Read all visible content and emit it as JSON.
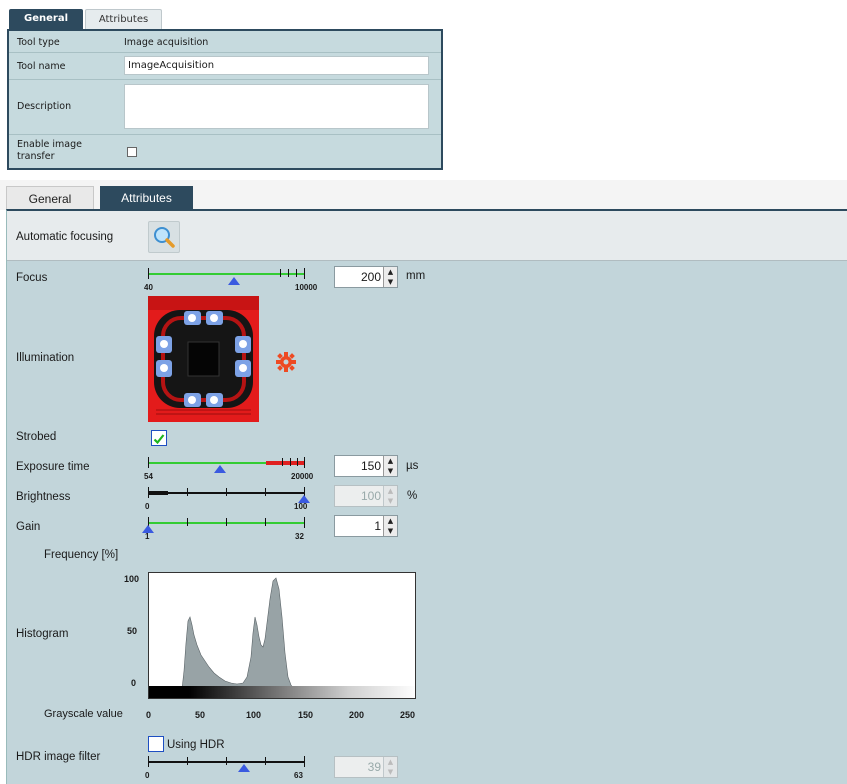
{
  "general_panel": {
    "tabs": {
      "general": "General",
      "attributes": "Attributes"
    },
    "tool_type_label": "Tool type",
    "tool_type_value": "Image acquisition",
    "tool_name_label": "Tool name",
    "tool_name_value": "ImageAcquisition",
    "description_label": "Description",
    "description_value": "",
    "enable_label_1": "Enable image",
    "enable_label_2": "transfer",
    "enable_checked": false
  },
  "attributes_panel": {
    "tabs": {
      "general": "General",
      "attributes": "Attributes"
    },
    "automatic_focusing_label": "Automatic focusing",
    "focus": {
      "label": "Focus",
      "min": "40",
      "max": "10000",
      "value": "200",
      "unit": "mm"
    },
    "illumination_label": "Illumination",
    "strobed": {
      "label": "Strobed",
      "checked": true
    },
    "exposure": {
      "label": "Exposure time",
      "min": "54",
      "max": "20000",
      "value": "150",
      "unit": "µs"
    },
    "brightness": {
      "label": "Brightness",
      "min": "0",
      "max": "100",
      "value": "100",
      "unit": "%"
    },
    "gain": {
      "label": "Gain",
      "min": "1",
      "max": "32",
      "value": "1"
    },
    "histogram": {
      "label": "Histogram",
      "y_title": "Frequency [%]",
      "x_title": "Grayscale value",
      "y_ticks": [
        "100",
        "50",
        "0"
      ],
      "x_ticks": [
        "0",
        "50",
        "100",
        "150",
        "200",
        "250"
      ]
    },
    "hdr": {
      "label": "HDR image filter",
      "checkbox_label": "Using HDR",
      "checked": false,
      "min": "0",
      "max": "63",
      "value": "39"
    }
  },
  "colors": {
    "tab_dark": "#2d4a5e",
    "panel_bg": "#c2d5da",
    "slider_green": "#33cc33",
    "slider_red": "#e02020",
    "thumb_blue": "#3a5ae0"
  }
}
